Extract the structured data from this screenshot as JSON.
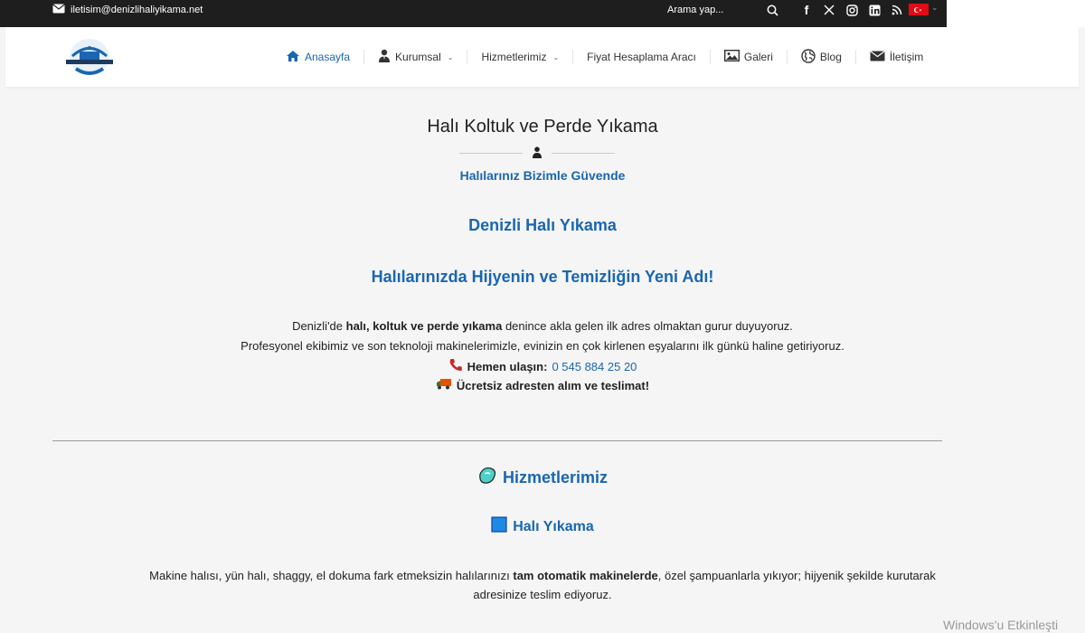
{
  "topbar": {
    "email": "iletisim@denizlihaliyikama.net",
    "search_placeholder": "Arama yap...",
    "social_icons": [
      "facebook-icon",
      "x-icon",
      "instagram-icon",
      "linkedin-icon",
      "rss-icon"
    ],
    "language_flag": "turkey-flag-icon"
  },
  "nav": {
    "items": [
      {
        "label": "Anasayfa",
        "icon": "home-icon",
        "active": true
      },
      {
        "label": "Kurumsal",
        "icon": "user-tie-icon",
        "dropdown": true
      },
      {
        "label": "Hizmetlerimiz",
        "dropdown": true
      },
      {
        "label": "Fiyat Hesaplama Aracı"
      },
      {
        "label": "Galeri",
        "icon": "image-icon"
      },
      {
        "label": "Blog",
        "icon": "globe-icon"
      },
      {
        "label": "İletişim",
        "icon": "envelope-icon"
      }
    ]
  },
  "content": {
    "title": "Halı Koltuk ve Perde Yıkama",
    "subtitle": "Halılarınız Bizimle Güvende",
    "heading1": "Denizli Halı Yıkama",
    "heading2": "Halılarınızda Hijyenin ve Temizliğin Yeni Adı!",
    "para1_prefix": "Denizli'de ",
    "para1_bold": "halı, koltuk ve perde yıkama",
    "para1_suffix": " denince akla gelen ilk adres olmaktan gurur duyuyoruz.",
    "para2": "Profesyonel ekibimiz ve son teknoloji makinelerimizle, evinizin en çok kirlenen eşyalarını ilk günkü haline getiriyoruz.",
    "contact_label": "Hemen ulaşın:",
    "phone": "0 545 884 25 20",
    "delivery": "Ücretsiz adresten alım ve teslimat!",
    "services_heading": "Hizmetlerimiz",
    "service1_heading": "Halı Yıkama",
    "service1_prefix": "Makine halısı, yün halı, shaggy, el dokuma fark etmeksizin halılarınızı ",
    "service1_bold": "tam otomatik makinelerde",
    "service1_suffix": ", özel şampuanlarla yıkıyor; hijyenik şekilde kurutarak",
    "service1_line2": "adresinize teslim ediyoruz."
  },
  "watermark": "Windows'u Etkinleşti",
  "colors": {
    "accent": "#1a66b1",
    "topbar": "#1e1e1e",
    "background": "#f5f5f5",
    "flag": "#e30a17"
  }
}
